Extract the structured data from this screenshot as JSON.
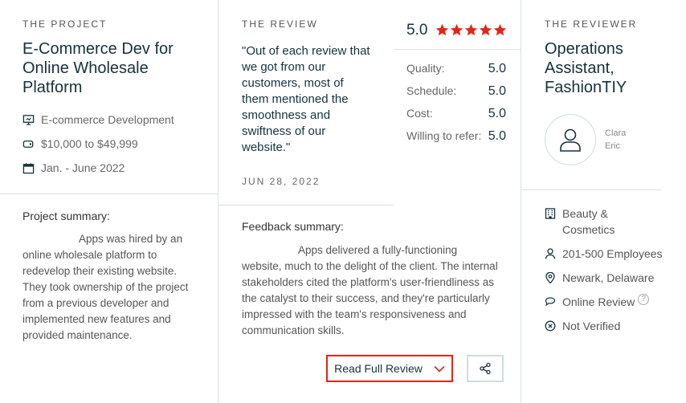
{
  "project": {
    "eyebrow": "THE PROJECT",
    "title_lines": [
      "E-Commerce Dev for",
      "Online Wholesale",
      "Platform"
    ],
    "service": "E-commerce Development",
    "budget": "$10,000 to $49,999",
    "dates": "Jan. - June 2022",
    "summary_label": "Project summary:",
    "summary_lines": [
      "Apps was hired by an",
      "online wholesale platform to",
      "redevelop their existing website.",
      "They took ownership of the project",
      "from a previous developer and",
      "implemented new features and",
      "provided maintenance."
    ]
  },
  "review": {
    "eyebrow": "THE REVIEW",
    "quote_lines": [
      "\"Out of each review that",
      "we got from our",
      "customers, most of",
      "them mentioned the",
      "smoothness and",
      "swiftness of our",
      "website.\""
    ],
    "date": "JUN 28, 2022",
    "feedback_label": "Feedback summary:",
    "feedback_lines": [
      "Apps delivered a fully-functioning",
      "website, much to the delight of the client. The internal",
      "stakeholders cited the platform's user-friendliness as",
      "the catalyst to their success, and they're particularly",
      "impressed with the team's responsiveness and",
      "communication skills."
    ],
    "read_button": "Read Full Review"
  },
  "ratings": {
    "overall": "5.0",
    "star_count": 5,
    "star_color": "#e62415",
    "scores": [
      {
        "label": "Quality:",
        "value": "5.0"
      },
      {
        "label": "Schedule:",
        "value": "5.0"
      },
      {
        "label": "Cost:",
        "value": "5.0"
      },
      {
        "label": "Willing to refer:",
        "value": "5.0"
      }
    ]
  },
  "reviewer": {
    "eyebrow": "THE REVIEWER",
    "title_lines": [
      "Operations",
      "Assistant,",
      "FashionTIY"
    ],
    "name_lines": [
      "Clara",
      "Eric"
    ],
    "industry_lines": [
      "Beauty &",
      "Cosmetics"
    ],
    "employees": "201-500 Employees",
    "location": "Newark, Delaware",
    "review_type": "Online Review",
    "verification": "Not Verified"
  }
}
